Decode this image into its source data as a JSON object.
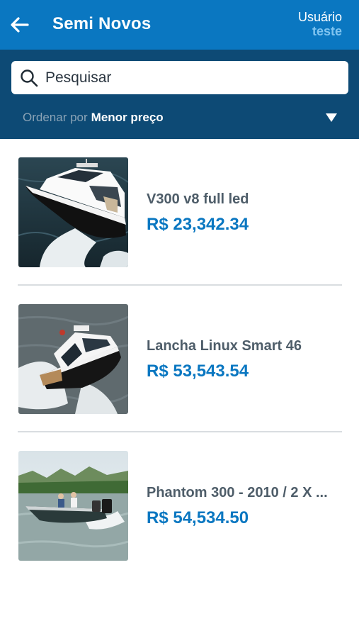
{
  "header": {
    "title": "Semi Novos",
    "user_label": "Usuário",
    "user_name": "teste",
    "background_color": "#0a77c1"
  },
  "search": {
    "placeholder": "Pesquisar",
    "value": ""
  },
  "sort": {
    "prefix": "Ordenar por",
    "value": "Menor preço"
  },
  "items": [
    {
      "name": "V300 v8 full led",
      "price": "R$ 23,342.34",
      "image": "yacht-photo"
    },
    {
      "name": "Lancha Linux Smart 46",
      "price": "R$ 53,543.54",
      "image": "speedboat-photo"
    },
    {
      "name": "Phantom 300 - 2010 / 2 X ...",
      "price": "R$ 54,534.50",
      "image": "fishing-boat-photo"
    }
  ],
  "colors": {
    "accent": "#0a77c1",
    "panel": "#0d4a75",
    "item_title": "#4e5d69"
  }
}
